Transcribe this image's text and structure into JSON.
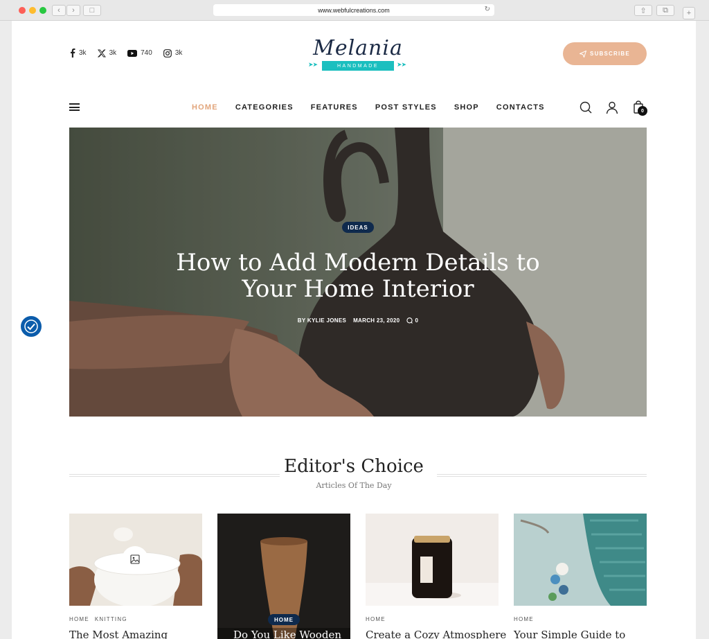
{
  "browser": {
    "url": "www.webfulcreations.com"
  },
  "social": [
    {
      "icon": "facebook-icon",
      "count": "3k"
    },
    {
      "icon": "x-twitter-icon",
      "count": "3k"
    },
    {
      "icon": "youtube-icon",
      "count": "740"
    },
    {
      "icon": "instagram-icon",
      "count": "3k"
    }
  ],
  "logo": {
    "name": "Melania",
    "tagline": "HANDMADE"
  },
  "subscribe_label": "SUBSCRIBE",
  "nav": [
    "HOME",
    "CATEGORIES",
    "FEATURES",
    "POST STYLES",
    "SHOP",
    "CONTACTS"
  ],
  "cart_count": "0",
  "hero": {
    "category": "IDEAS",
    "title_line1": "How to Add Modern Details to",
    "title_line2": "Your Home Interior",
    "author": "BY KYLIE JONES",
    "date": "MARCH 23, 2020",
    "comments": "0"
  },
  "editors_choice": {
    "title": "Editor's Choice",
    "subtitle": "Articles Of The Day",
    "cards": [
      {
        "cats": [
          "HOME",
          "KNITTING"
        ],
        "title": "The Most Amazing"
      },
      {
        "badge": "HOME",
        "title": "Do You Like Wooden"
      },
      {
        "cats": [
          "HOME"
        ],
        "title": "Create a Cozy Atmosphere"
      },
      {
        "cats": [
          "HOME"
        ],
        "title": "Your Simple Guide to"
      }
    ]
  },
  "colors": {
    "accent": "#e2a57b",
    "subscribe": "#e9b594",
    "ribbon": "#1bbfbf",
    "badge": "#0f2a4d"
  }
}
